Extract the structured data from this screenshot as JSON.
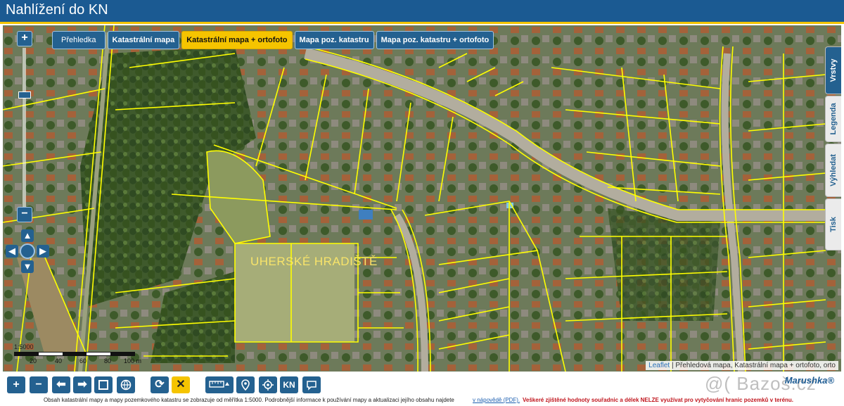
{
  "header": {
    "title": "Nahlížení do KN"
  },
  "layer_tabs": [
    {
      "label": "Přehledka",
      "active": false
    },
    {
      "label": "Katastrální mapa",
      "active": false
    },
    {
      "label": "Katastrální mapa + ortofoto",
      "active": true
    },
    {
      "label": "Mapa poz. katastru",
      "active": false
    },
    {
      "label": "Mapa poz. katastru + ortofoto",
      "active": false
    }
  ],
  "zoom": {
    "in": "+",
    "out": "−"
  },
  "side_tabs": [
    {
      "label": "Vrstvy",
      "active": true
    },
    {
      "label": "Legenda",
      "active": false
    },
    {
      "label": "Výhledat",
      "active": false
    },
    {
      "label": "Tisk",
      "active": false
    }
  ],
  "map": {
    "place_label": "UHERSKÉ HRADIŠTĚ",
    "scale_ratio": "1:5000",
    "scale_ticks": [
      "20",
      "40",
      "60",
      "80",
      "100 m"
    ],
    "attribution_link": "Leaflet",
    "attribution_text": "| Přehledová mapa, Katastrální mapa + ortofoto, orto"
  },
  "toolbar": {
    "buttons": [
      "zoom-in",
      "zoom-out",
      "back",
      "forward",
      "extent",
      "globe",
      "refresh",
      "clear",
      "measure",
      "location",
      "gps",
      "kn",
      "chat"
    ],
    "kn_label": "KN"
  },
  "footer": {
    "text": "Obsah katastrální mapy a mapy pozemkového katastru se zobrazuje od měřítka 1:5000. Podrobnější informace k používání mapy a aktualizaci jejího obsahu najdete",
    "link": "v nápovědě (PDF).",
    "warning": "Veškeré zjištěné hodnoty souřadnic a délek NELZE využívat pro vytyčování hranic pozemků v terénu."
  },
  "brand": "Marushka®",
  "watermark": "@( Bazoš.cz",
  "colors": {
    "header": "#1b5a92",
    "accent": "#f5c400",
    "parcel_lines": "#ffff00",
    "button": "#246190"
  }
}
